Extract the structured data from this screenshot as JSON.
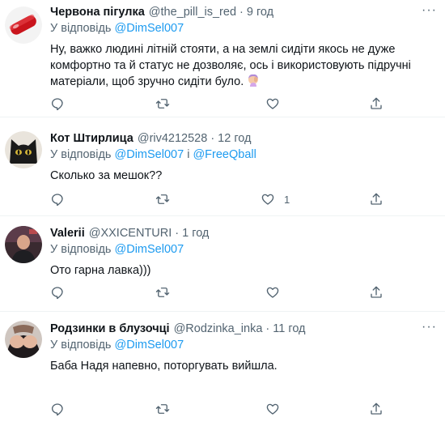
{
  "tweets": [
    {
      "name": "Червона пігулка",
      "handle": "@the_pill_is_red",
      "time": "9 год",
      "reply_prefix": "У відповідь",
      "reply_to": [
        "@DimSel007"
      ],
      "reply_joiner": "",
      "text": "Ну, важко людині літній стояти, а на землі сидіти якось не дуже комфортно та й статус не дозволяє, ось і використовують підручні матеріали, щоб зручно сидіти було.",
      "likes": "",
      "avatar": "red-pill"
    },
    {
      "name": "Кот Штирлица",
      "handle": "@riv4212528",
      "time": "12 год",
      "reply_prefix": "У відповідь",
      "reply_to": [
        "@DimSel007",
        "@FreeQball"
      ],
      "reply_joiner": "і",
      "text": "Сколько за мешок??",
      "likes": "1",
      "avatar": "black-cat"
    },
    {
      "name": "Valerii",
      "handle": "@XXICENTURI",
      "time": "1 год",
      "reply_prefix": "У відповідь",
      "reply_to": [
        "@DimSel007"
      ],
      "reply_joiner": "",
      "text": "Ото гарна лавка)))",
      "likes": "",
      "avatar": "person-photo"
    },
    {
      "name": "Родзинки в блузочці",
      "handle": "@Rodzinka_inka",
      "time": "11 год",
      "reply_prefix": "У відповідь",
      "reply_to": [
        "@DimSel007"
      ],
      "reply_joiner": "",
      "text": "Баба Надя напевно, поторгувать вийшла.",
      "likes": "",
      "avatar": "person-photo"
    }
  ],
  "icons": {
    "reply": "reply-icon",
    "retweet": "retweet-icon",
    "like": "heart-icon",
    "share": "share-icon",
    "more": "more-icon",
    "emoji": "woman-facepalming-emoji"
  },
  "colors": {
    "accent": "#1d9bf0",
    "secondary_text": "#536471",
    "primary_text": "#0f1419",
    "divider": "#eff3f4"
  },
  "more_glyph": "···",
  "dot": "·"
}
